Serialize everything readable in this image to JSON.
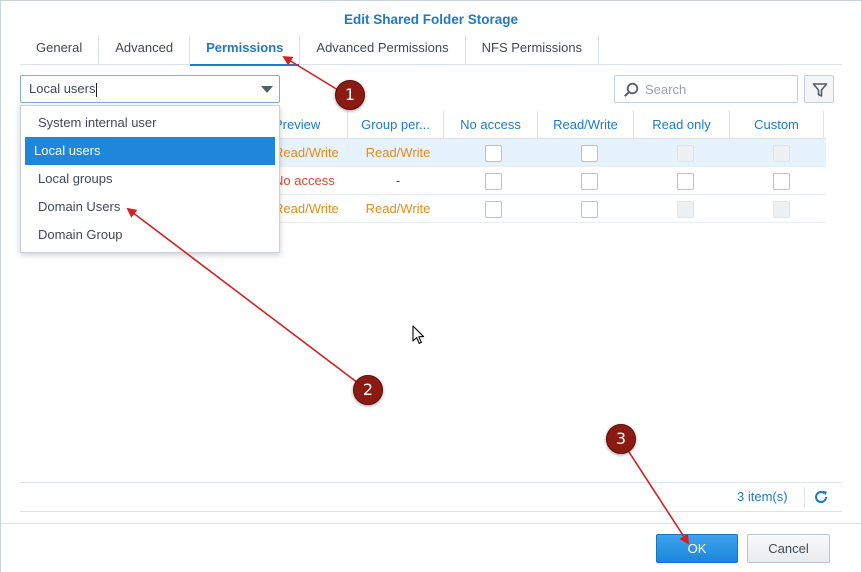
{
  "window": {
    "title": "Edit Shared Folder Storage"
  },
  "tabs": [
    {
      "label": "General",
      "active": false
    },
    {
      "label": "Advanced",
      "active": false
    },
    {
      "label": "Permissions",
      "active": true
    },
    {
      "label": "Advanced Permissions",
      "active": false
    },
    {
      "label": "NFS Permissions",
      "active": false
    }
  ],
  "user_type_select": {
    "value": "Local users",
    "options": [
      "System internal user",
      "Local users",
      "Local groups",
      "Domain Users",
      "Domain Group"
    ],
    "selected_index": 1
  },
  "search": {
    "placeholder": "Search",
    "icon": "search-icon"
  },
  "filter": {
    "icon": "filter-icon"
  },
  "grid": {
    "columns": [
      "Preview",
      "Group per...",
      "No access",
      "Read/Write",
      "Read only",
      "Custom"
    ],
    "rows": [
      {
        "preview": "Read/Write",
        "group_perm": "Read/Write",
        "selected": true
      },
      {
        "preview": "No access",
        "group_perm": "-",
        "selected": false
      },
      {
        "preview": "Read/Write",
        "group_perm": "Read/Write",
        "selected": false
      }
    ]
  },
  "footer": {
    "items_count": "3 item(s)",
    "refresh_icon": "refresh-icon"
  },
  "buttons": {
    "ok": "OK",
    "cancel": "Cancel"
  },
  "annotations": [
    {
      "number": "1"
    },
    {
      "number": "2"
    },
    {
      "number": "3"
    }
  ],
  "colors": {
    "accent": "#1e7ac6",
    "orange": "#e58c17",
    "red": "#e0452f",
    "annotation": "#d42020",
    "badge": "#8b1a12"
  }
}
